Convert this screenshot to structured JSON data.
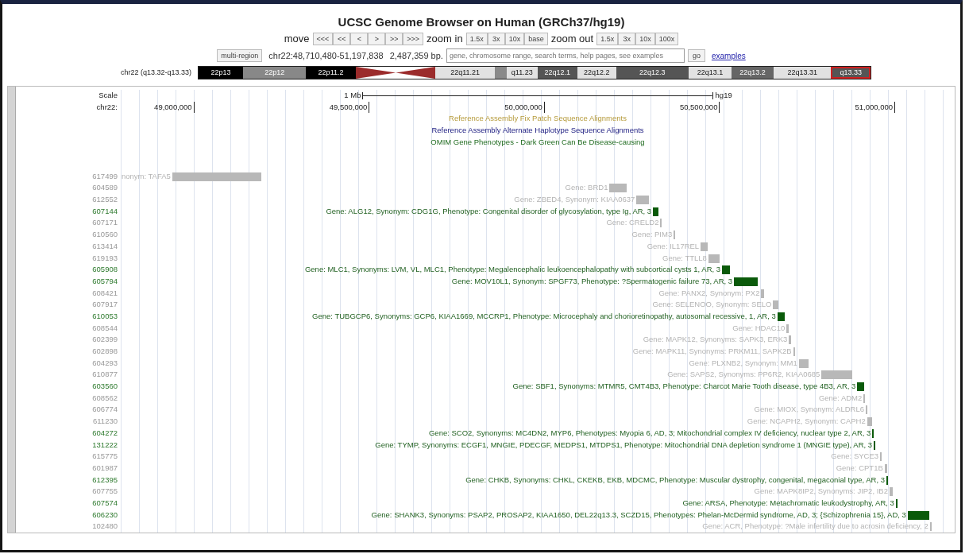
{
  "title": "UCSC Genome Browser on Human (GRCh37/hg19)",
  "navigation": {
    "move_label": "move",
    "move_buttons": [
      "<<<",
      "<<",
      "<",
      ">",
      ">>",
      ">>>"
    ],
    "zoom_in_label": "zoom in",
    "zoom_in_buttons": [
      "1.5x",
      "3x",
      "10x",
      "base"
    ],
    "zoom_out_label": "zoom out",
    "zoom_out_buttons": [
      "1.5x",
      "3x",
      "10x",
      "100x"
    ]
  },
  "position_bar": {
    "multi_region_button": "multi-region",
    "position": "chr22:48,710,480-51,197,838",
    "size": "2,487,359 bp.",
    "search": {
      "placeholder": "gene, chromosome range, search terms, help pages, see examples"
    },
    "go_button": "go",
    "examples_link": "examples"
  },
  "ideogram": {
    "label": "chr22 (q13.32-q13.33)",
    "bands": [
      {
        "label": "22p13",
        "color": "#000000",
        "kind": "band",
        "selected": false
      },
      {
        "label": "22p12",
        "color": "#888888",
        "kind": "band",
        "selected": false
      },
      {
        "label": "22p11.2",
        "color": "#000000",
        "kind": "band",
        "selected": false
      },
      {
        "color": "#9b2b2b",
        "kind": "centromere",
        "selected": false
      },
      {
        "label": "22q11.21",
        "color": "#e2e2e2",
        "kind": "band",
        "selected": false
      },
      {
        "color": "#8a8a8a",
        "kind": "band",
        "selected": false
      },
      {
        "label": "q11.23",
        "color": "#e2e2e2",
        "kind": "band",
        "selected": false
      },
      {
        "label": "22q12.1",
        "color": "#555555",
        "kind": "band",
        "selected": false
      },
      {
        "label": "22q12.2",
        "color": "#e2e2e2",
        "kind": "band",
        "selected": false
      },
      {
        "label": "22q12.3",
        "color": "#555555",
        "kind": "band",
        "selected": false
      },
      {
        "label": "22q13.1",
        "color": "#e2e2e2",
        "kind": "band",
        "selected": false
      },
      {
        "label": "22q13.2",
        "color": "#666666",
        "kind": "band",
        "selected": false
      },
      {
        "label": "22q13.31",
        "color": "#e2e2e2",
        "kind": "band",
        "selected": false
      },
      {
        "label": "q13.33",
        "color": "#555555",
        "kind": "band",
        "selected": true
      }
    ]
  },
  "track": {
    "scale_label": "Scale",
    "scale_bar": {
      "label": "1 Mb",
      "assembly": "hg19"
    },
    "chrom_label": "chr22:",
    "ticks": [
      {
        "label": "49,000,000"
      },
      {
        "label": "49,500,000"
      },
      {
        "label": "50,000,000"
      },
      {
        "label": "50,500,000"
      },
      {
        "label": "51,000,000"
      }
    ],
    "track_titles": [
      {
        "text": "Reference Assembly Fix Patch Sequence Alignments",
        "kind": "patch"
      },
      {
        "text": "Reference Assembly Alternate Haplotype Sequence Alignments",
        "kind": "haplotype"
      },
      {
        "text": "OMIM Gene Phenotypes - Dark Green Can Be Disease-causing",
        "kind": "phenotype"
      }
    ],
    "features": [
      {
        "id": "617499",
        "label": "nonym: TAFA5",
        "kind": "other"
      },
      {
        "id": "604589",
        "label": "Gene: BRD1",
        "kind": "other"
      },
      {
        "id": "612552",
        "label": "Gene: ZBED4, Synonym:  KIAA0637",
        "kind": "other"
      },
      {
        "id": "607144",
        "label": "Gene: ALG12, Synonym:  CDG1G, Phenotype: Congenital disorder of glycosylation, type Ig, AR, 3",
        "kind": "disease"
      },
      {
        "id": "607171",
        "label": "Gene: CRELD2",
        "kind": "other"
      },
      {
        "id": "610560",
        "label": "Gene: PIM3",
        "kind": "other"
      },
      {
        "id": "613414",
        "label": "Gene: IL17REL",
        "kind": "other"
      },
      {
        "id": "619193",
        "label": "Gene: TTLL8",
        "kind": "other"
      },
      {
        "id": "605908",
        "label": "Gene: MLC1, Synonyms:  LVM, VL, MLC1, Phenotype: Megalencephalic leukoencephalopathy with subcortical cysts 1, AR, 3",
        "kind": "disease"
      },
      {
        "id": "605794",
        "label": "Gene: MOV10L1, Synonym:  SPGF73, Phenotype: ?Spermatogenic failure 73, AR, 3",
        "kind": "disease"
      },
      {
        "id": "608421",
        "label": "Gene: PANX2, Synonym:  PX2",
        "kind": "other"
      },
      {
        "id": "607917",
        "label": "Gene: SELENOO, Synonym:  SELO",
        "kind": "other"
      },
      {
        "id": "610053",
        "label": "Gene: TUBGCP6, Synonyms:  GCP6, KIAA1669, MCCRP1, Phenotype: Microcephaly and chorioretinopathy, autosomal recessive, 1, AR, 3",
        "kind": "disease"
      },
      {
        "id": "608544",
        "label": "Gene: HDAC10",
        "kind": "other"
      },
      {
        "id": "602399",
        "label": "Gene: MAPK12, Synonyms:  SAPK3, ERK3",
        "kind": "other"
      },
      {
        "id": "602898",
        "label": "Gene: MAPK11, Synonyms:  PRKM11, SAPK2B",
        "kind": "other"
      },
      {
        "id": "604293",
        "label": "Gene: PLXNB2, Synonym:  MM1",
        "kind": "other"
      },
      {
        "id": "610877",
        "label": "Gene: SAPS2, Synonyms:  PP6R2, KIAA0685",
        "kind": "other"
      },
      {
        "id": "603560",
        "label": "Gene: SBF1, Synonyms:  MTMR5, CMT4B3, Phenotype: Charcot Marie Tooth disease, type 4B3, AR, 3",
        "kind": "disease"
      },
      {
        "id": "608562",
        "label": "Gene: ADM2",
        "kind": "other"
      },
      {
        "id": "606774",
        "label": "Gene: MIOX, Synonym:  ALDRL6",
        "kind": "other"
      },
      {
        "id": "611230",
        "label": "Gene: NCAPH2, Synonym:  CAPH2",
        "kind": "other"
      },
      {
        "id": "604272",
        "label": "Gene: SCO2, Synonyms:  MC4DN2, MYP6, Phenotypes: Myopia 6, AD, 3; Mitochondrial complex IV deficiency, nuclear type 2, AR, 3",
        "kind": "disease"
      },
      {
        "id": "131222",
        "label": "Gene: TYMP, Synonyms:  ECGF1, MNGIE, PDECGF, MEDPS1, MTDPS1, Phenotype: Mitochondrial DNA depletion syndrome 1 (MNGIE type), AR, 3",
        "kind": "disease"
      },
      {
        "id": "615775",
        "label": "Gene: SYCE3",
        "kind": "other"
      },
      {
        "id": "601987",
        "label": "Gene: CPT1B",
        "kind": "other"
      },
      {
        "id": "612395",
        "label": "Gene: CHKB, Synonyms:  CHKL, CKEKB, EKB, MDCMC, Phenotype: Muscular dystrophy, congenital, megaconial type, AR, 3",
        "kind": "disease"
      },
      {
        "id": "607755",
        "label": "Gene: MAPK8IP2, Synonyms:  JIP2, IB2",
        "kind": "other"
      },
      {
        "id": "607574",
        "label": "Gene: ARSA, Phenotype: Metachromatic leukodystrophy, AR, 3",
        "kind": "disease"
      },
      {
        "id": "606230",
        "label": "Gene: SHANK3, Synonyms:  PSAP2, PROSAP2, KIAA1650, DEL22q13.3, SCZD15, Phenotypes: Phelan-McDermid syndrome, AD, 3; {Schizophrenia 15}, AD, 3",
        "kind": "disease"
      },
      {
        "id": "102480",
        "label": "Gene: ACR, Phenotype: ?Male infertility due to acrosin deficiency, 2",
        "kind": "other"
      }
    ]
  }
}
